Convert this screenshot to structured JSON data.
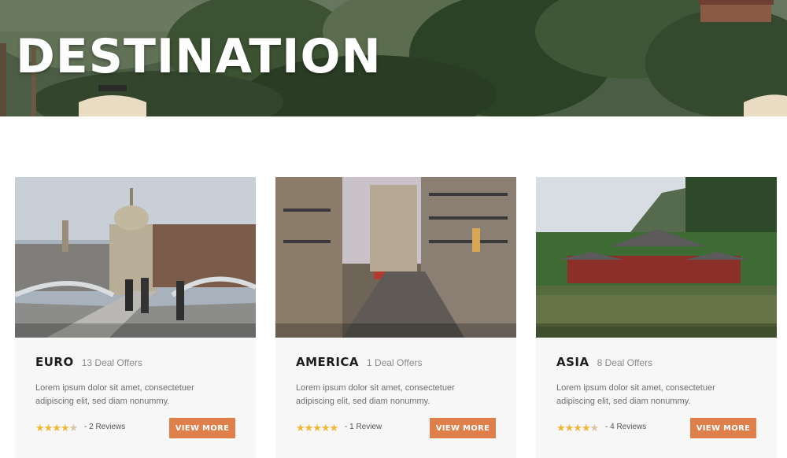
{
  "hero": {
    "title": "DESTINATION"
  },
  "cards": [
    {
      "title": "EURO",
      "offers": "13 Deal Offers",
      "description": "Lorem ipsum dolor sit amet, consectetuer adipiscing elit, sed diam nonummy.",
      "rating": 4.5,
      "reviews": "- 2 Reviews",
      "button": "VIEW MORE"
    },
    {
      "title": "AMERICA",
      "offers": "1 Deal Offers",
      "description": "Lorem ipsum dolor sit amet, consectetuer adipiscing elit, sed diam nonummy.",
      "rating": 5,
      "reviews": "- 1 Review",
      "button": "VIEW MORE"
    },
    {
      "title": "ASIA",
      "offers": "8 Deal Offers",
      "description": "Lorem ipsum dolor sit amet, consectetuer adipiscing elit, sed diam nonummy.",
      "rating": 4.5,
      "reviews": "- 4 Reviews",
      "button": "VIEW MORE"
    }
  ],
  "colors": {
    "accent": "#df7f4a",
    "star": "#f2b632",
    "card_bg": "#f7f7f7"
  }
}
